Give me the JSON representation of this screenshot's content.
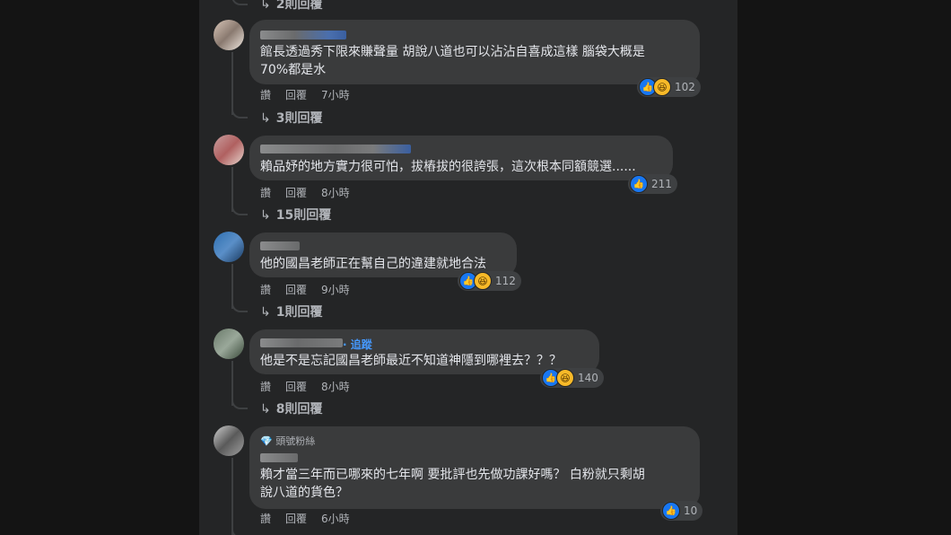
{
  "top_reply": {
    "label": "2則回覆"
  },
  "comments": [
    {
      "text_lines": [
        "館長透過秀下限來賺聲量 胡說八道也可以沾沾自喜成這樣 腦袋大概是",
        "70%都是水"
      ],
      "like_label": "讚",
      "reply_label": "回覆",
      "time": "7小時",
      "reactions": [
        "like",
        "haha"
      ],
      "count": "102",
      "replies": "3則回覆"
    },
    {
      "text_lines": [
        "賴品妤的地方實力很可怕，拔樁拔的很誇張，這次根本同額競選......"
      ],
      "like_label": "讚",
      "reply_label": "回覆",
      "time": "8小時",
      "reactions": [
        "like"
      ],
      "count": "211",
      "replies": "15則回覆"
    },
    {
      "text_lines": [
        "他的國昌老師正在幫自己的違建就地合法"
      ],
      "like_label": "讚",
      "reply_label": "回覆",
      "time": "9小時",
      "reactions": [
        "like",
        "haha"
      ],
      "count": "112",
      "replies": "1則回覆"
    },
    {
      "text_lines": [
        "他是不是忘記國昌老師最近不知道神隱到哪裡去？？？"
      ],
      "like_label": "讚",
      "reply_label": "回覆",
      "time": "8小時",
      "reactions": [
        "like",
        "haha"
      ],
      "count": "140",
      "replies": "8則回覆",
      "follow": "· 追蹤"
    },
    {
      "badge": "頭號粉絲",
      "text_lines": [
        "賴才當三年而已哪來的七年啊 要批評也先做功課好嗎？ 白粉就只剩胡",
        "說八道的貨色？"
      ],
      "like_label": "讚",
      "reply_label": "回覆",
      "time": "6小時",
      "reactions": [
        "like"
      ],
      "count": "10"
    }
  ],
  "icons": {
    "like": "thumbs-up-icon",
    "haha": "laughing-face-icon",
    "reply_arrow": "reply-arrow-icon",
    "badge": "diamond-icon"
  },
  "colors": {
    "background": "#141414",
    "panel": "#242526",
    "bubble": "#3a3b3c",
    "like_blue": "#1877f2",
    "link_blue": "#4599ff"
  }
}
